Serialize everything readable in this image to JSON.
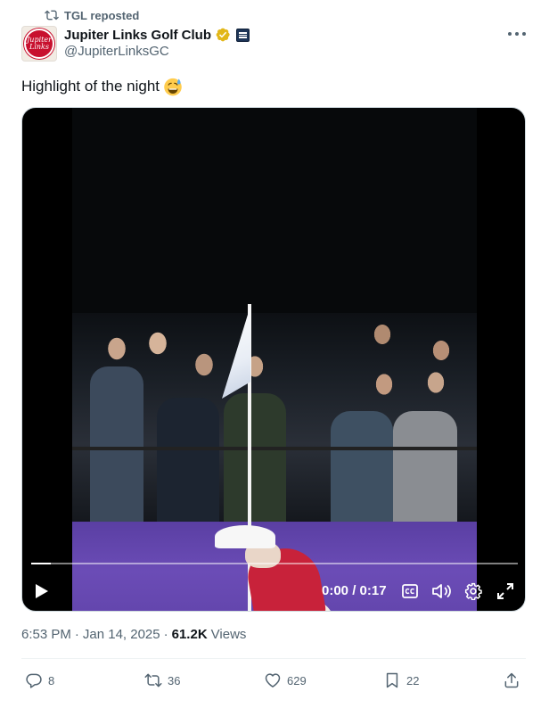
{
  "repost": {
    "label": "TGL reposted"
  },
  "author": {
    "display_name": "Jupiter Links Golf Club",
    "handle": "@JupiterLinksGC",
    "avatar_text": "Jupiter Links",
    "verified": "gold-verified-badge",
    "affiliate": "affiliate-badge"
  },
  "tweet": {
    "text": "Highlight of the night",
    "emoji": "sweat-smile-emoji"
  },
  "video": {
    "current_time": "0:00",
    "separator": " / ",
    "duration": "0:17",
    "progress": 0.01
  },
  "meta": {
    "time": "6:53 PM",
    "sep1": "·",
    "date": "Jan 14, 2025",
    "sep2": "·",
    "views_count": "61.2K",
    "views_label": "Views"
  },
  "actions": {
    "replies": "8",
    "reposts": "36",
    "likes": "629",
    "bookmarks": "22"
  },
  "colors": {
    "text_primary": "#0f1419",
    "text_secondary": "#536471",
    "verified_gold": "#e2b719",
    "brand_red": "#c8102e"
  }
}
